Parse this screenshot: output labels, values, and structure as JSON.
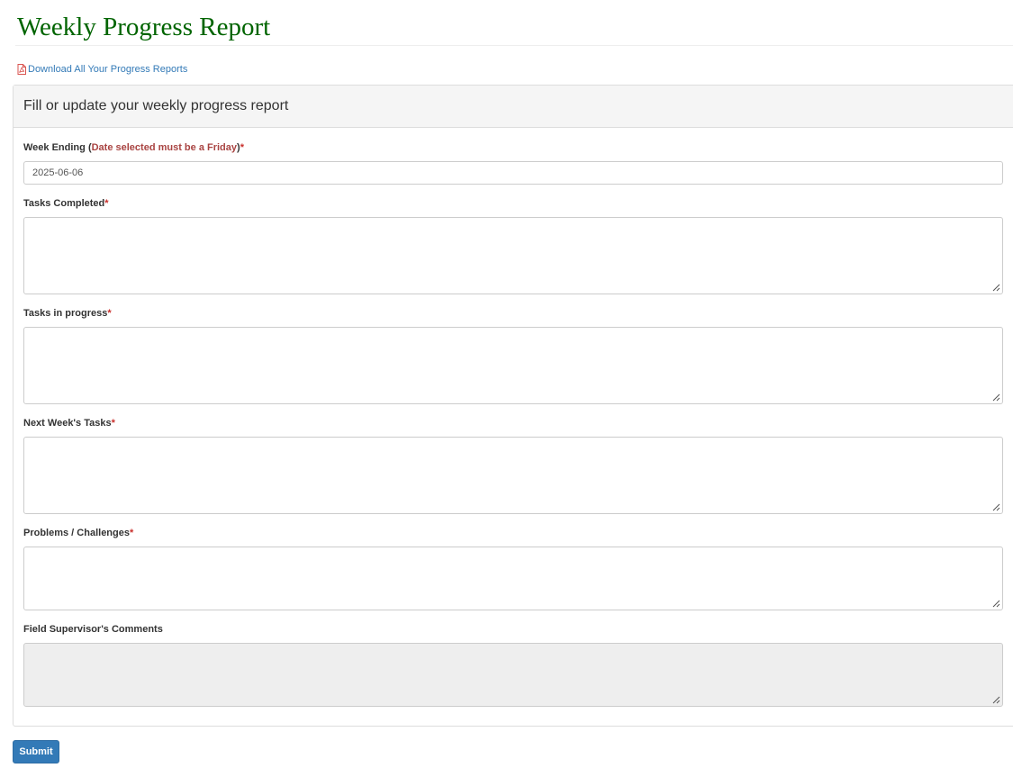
{
  "page": {
    "title": "Weekly Progress Report",
    "download_link": "Download All Your Progress Reports"
  },
  "panel": {
    "heading": "Fill or update your weekly progress report"
  },
  "form": {
    "week_ending": {
      "label": "Week Ending",
      "open_paren": "(",
      "hint": "Date selected must be a Friday",
      "close_paren": ")",
      "required_mark": "*",
      "value": "2025-06-06"
    },
    "tasks_completed": {
      "label": "Tasks Completed",
      "required_mark": "*",
      "value": ""
    },
    "tasks_in_progress": {
      "label": "Tasks in progress",
      "required_mark": "*",
      "value": ""
    },
    "next_week_tasks": {
      "label": "Next Week's Tasks",
      "required_mark": "*",
      "value": ""
    },
    "problems_challenges": {
      "label": "Problems / Challenges",
      "required_mark": "*",
      "value": ""
    },
    "supervisor_comments": {
      "label": "Field Supervisor's Comments",
      "value": ""
    },
    "submit_label": "Submit"
  },
  "colors": {
    "title": "#006400",
    "link": "#337ab7",
    "required": "#c9302c",
    "hint": "#a94442",
    "primary_button": "#337ab7"
  },
  "icons": {
    "download": "file-pdf-icon",
    "resize": "resize-grip-icon"
  }
}
